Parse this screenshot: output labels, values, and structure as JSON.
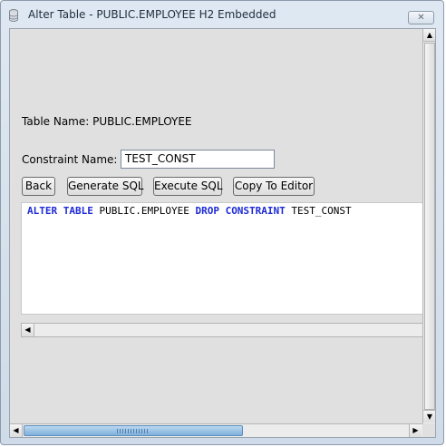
{
  "window": {
    "title": "Alter Table - PUBLIC.EMPLOYEE H2 Embedded",
    "close_label": "✕"
  },
  "form": {
    "table_name_label": "Table Name: PUBLIC.EMPLOYEE",
    "constraint_label": "Constraint Name:",
    "constraint_value": "TEST_CONST"
  },
  "buttons": {
    "back": "Back",
    "generate": "Generate SQL",
    "execute": "Execute SQL",
    "copy": "Copy To Editor"
  },
  "sql": {
    "kw1": "ALTER TABLE",
    "t1": " PUBLIC.EMPLOYEE ",
    "kw2": "DROP CONSTRAINT",
    "t2": " TEST_CONST"
  },
  "icons": {
    "title": "database-icon",
    "up": "▲",
    "down": "▼",
    "left": "◀",
    "right": "▶"
  },
  "colors": {
    "sql_keyword": "#1e2ad6",
    "scroll_thumb": "#7fb0dc"
  }
}
